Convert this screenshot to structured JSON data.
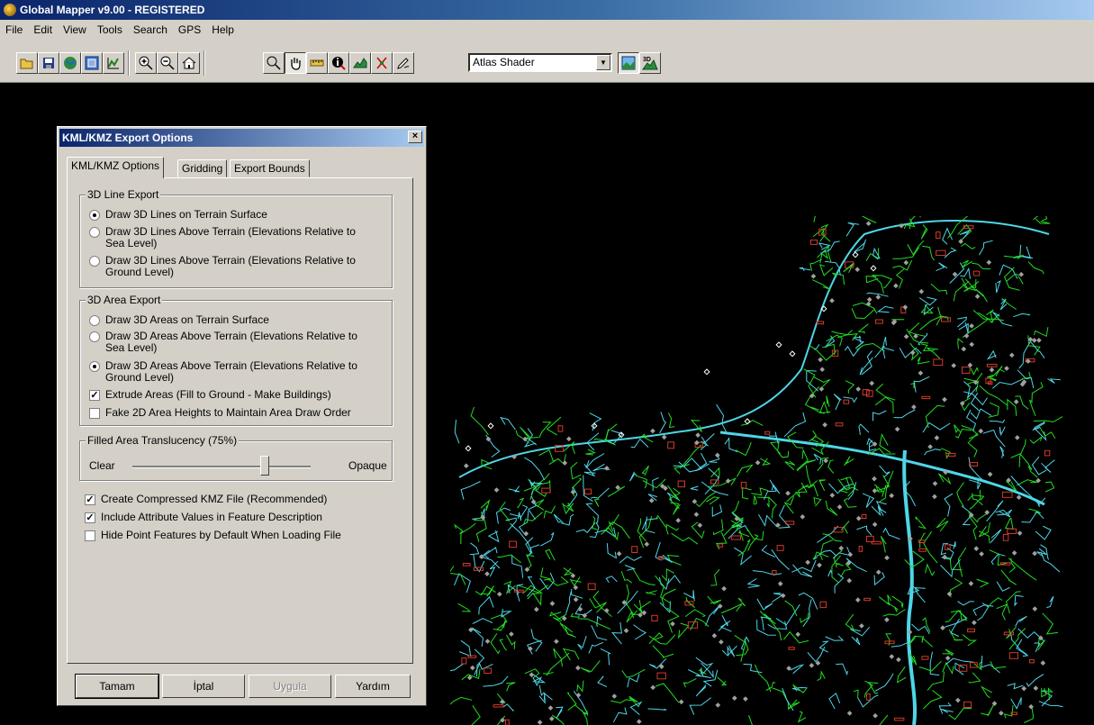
{
  "window": {
    "title": "Global Mapper v9.00 - REGISTERED"
  },
  "menu": [
    "File",
    "Edit",
    "View",
    "Tools",
    "Search",
    "GPS",
    "Help"
  ],
  "toolbar": {
    "icons": [
      "open-icon",
      "save-icon",
      "globe-icon",
      "overview-icon",
      "chart-icon",
      "zoom-in-icon",
      "zoom-out-icon",
      "home-icon",
      "select-icon",
      "pan-icon",
      "measure-icon",
      "info-icon",
      "path-profile-icon",
      "digitizer-icon",
      "edit-icon",
      "shader-2d-icon",
      "view-3d-icon"
    ],
    "shader_label": "Atlas Shader",
    "view3d_label": "3D"
  },
  "dialog": {
    "title": "KML/KMZ Export Options",
    "tabs": [
      "KML/KMZ Options",
      "Gridding",
      "Export Bounds"
    ],
    "line_group": {
      "legend": "3D Line Export",
      "options": [
        {
          "label": "Draw 3D Lines on Terrain Surface",
          "checked": true
        },
        {
          "label": "Draw 3D Lines Above Terrain (Elevations Relative to Sea Level)",
          "checked": false
        },
        {
          "label": "Draw 3D Lines Above Terrain (Elevations Relative to Ground Level)",
          "checked": false
        }
      ]
    },
    "area_group": {
      "legend": "3D Area Export",
      "options": [
        {
          "label": "Draw 3D Areas on Terrain Surface",
          "checked": false
        },
        {
          "label": "Draw 3D Areas Above Terrain (Elevations Relative to Sea Level)",
          "checked": false
        },
        {
          "label": "Draw 3D Areas Above Terrain (Elevations Relative to Ground Level)",
          "checked": true
        }
      ],
      "extrude": {
        "label": "Extrude Areas (Fill to Ground - Make Buildings)",
        "checked": true
      },
      "fake2d": {
        "label": "Fake 2D Area Heights to Maintain Area Draw Order",
        "checked": false
      }
    },
    "translucency": {
      "legend": "Filled Area Translucency (75%)",
      "min_label": "Clear",
      "max_label": "Opaque",
      "value": 75
    },
    "options": [
      {
        "label": "Create Compressed KMZ File (Recommended)",
        "checked": true
      },
      {
        "label": "Include Attribute Values in Feature Description",
        "checked": true
      },
      {
        "label": "Hide Point Features by Default When Loading File",
        "checked": false
      }
    ],
    "buttons": {
      "ok": "Tamam",
      "cancel": "İptal",
      "apply": "Uygula",
      "help": "Yardım"
    }
  },
  "colors": {
    "background": "#000000",
    "water": "#4fd6e8",
    "roads": "#22dd22",
    "buildings": "#d33a2a",
    "points": "#a0a0a0"
  }
}
